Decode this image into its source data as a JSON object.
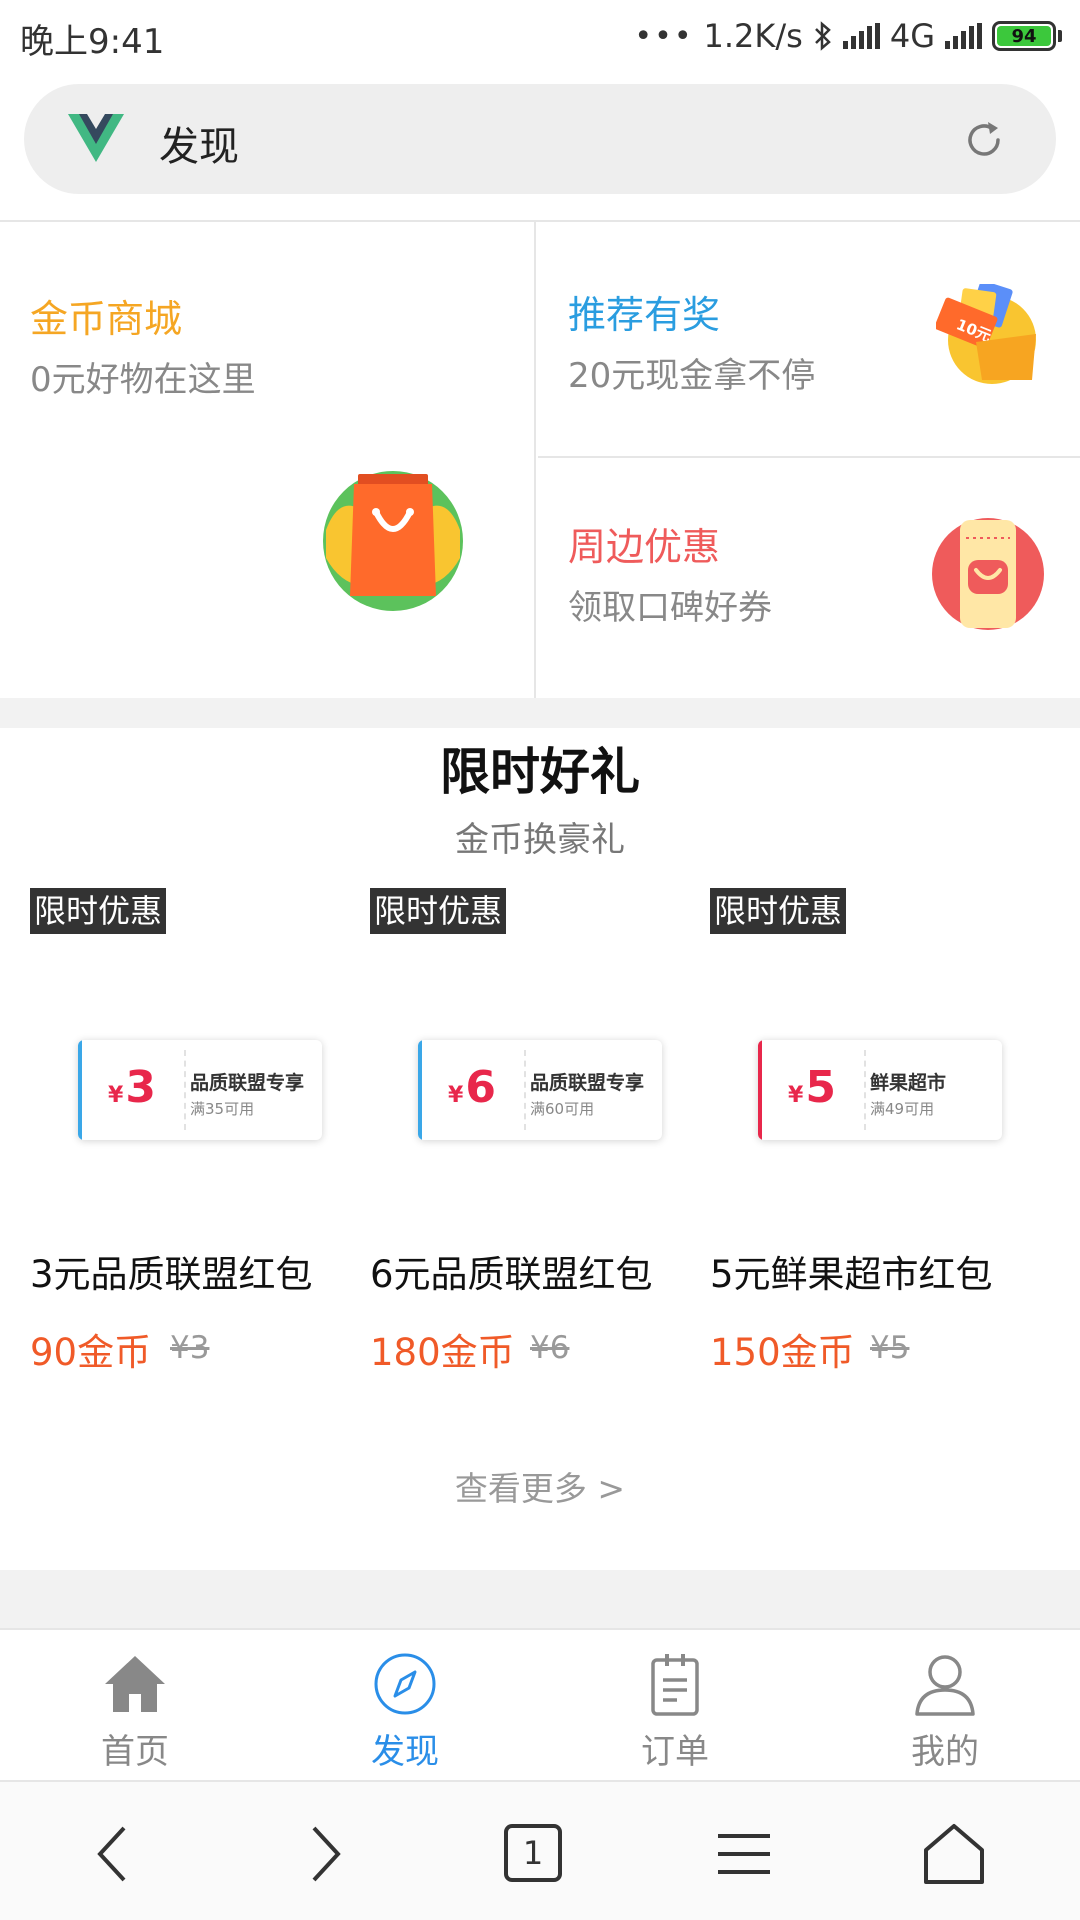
{
  "status_bar": {
    "time": "晚上9:41",
    "network_speed": "1.2K/s",
    "network_type": "4G",
    "battery_level": "94",
    "icons": [
      "bluetooth-icon",
      "signal-icon",
      "battery-icon"
    ]
  },
  "browser": {
    "title": "发现",
    "logo_icon": "vue-logo-icon",
    "action_icon": "refresh-icon"
  },
  "promos": {
    "coin_mall": {
      "title": "金币商城",
      "subtitle": "0元好物在这里",
      "color": "#f5a623",
      "icon": "shopping-bag-icon"
    },
    "referral": {
      "title": "推荐有奖",
      "subtitle": "20元现金拿不停",
      "color": "#2a9de0",
      "icon": "cash-envelope-icon"
    },
    "nearby": {
      "title": "周边优惠",
      "subtitle": "领取口碑好券",
      "color": "#ef5b5b",
      "icon": "coupon-icon"
    }
  },
  "limited": {
    "title": "限时好礼",
    "subtitle": "金币换豪礼",
    "view_more": "查看更多 >",
    "products": [
      {
        "badge": "限时优惠",
        "amount": "3",
        "currency": "¥",
        "coupon_name": "品质联盟专享",
        "coupon_cond": "满35可用",
        "name": "3元品质联盟红包",
        "price": "90金币",
        "original": "¥3",
        "stripe_color": "#3aa7e8"
      },
      {
        "badge": "限时优惠",
        "amount": "6",
        "currency": "¥",
        "coupon_name": "品质联盟专享",
        "coupon_cond": "满60可用",
        "name": "6元品质联盟红包",
        "price": "180金币",
        "original": "¥6",
        "stripe_color": "#3aa7e8"
      },
      {
        "badge": "限时优惠",
        "amount": "5",
        "currency": "¥",
        "coupon_name": "鲜果超市",
        "coupon_cond": "满49可用",
        "name": "5元鲜果超市红包",
        "price": "150金币",
        "original": "¥5",
        "stripe_color": "#e8274b"
      }
    ]
  },
  "tabbar": {
    "active_color": "#2a8ee8",
    "items": [
      {
        "label": "首页",
        "icon": "home-icon",
        "active": false
      },
      {
        "label": "发现",
        "icon": "compass-icon",
        "active": true
      },
      {
        "label": "订单",
        "icon": "clipboard-icon",
        "active": false
      },
      {
        "label": "我的",
        "icon": "user-icon",
        "active": false
      }
    ]
  },
  "system_nav": {
    "tab_count": "1",
    "icons": [
      "back-icon",
      "forward-icon",
      "tabs-icon",
      "menu-icon",
      "home-nav-icon"
    ]
  }
}
